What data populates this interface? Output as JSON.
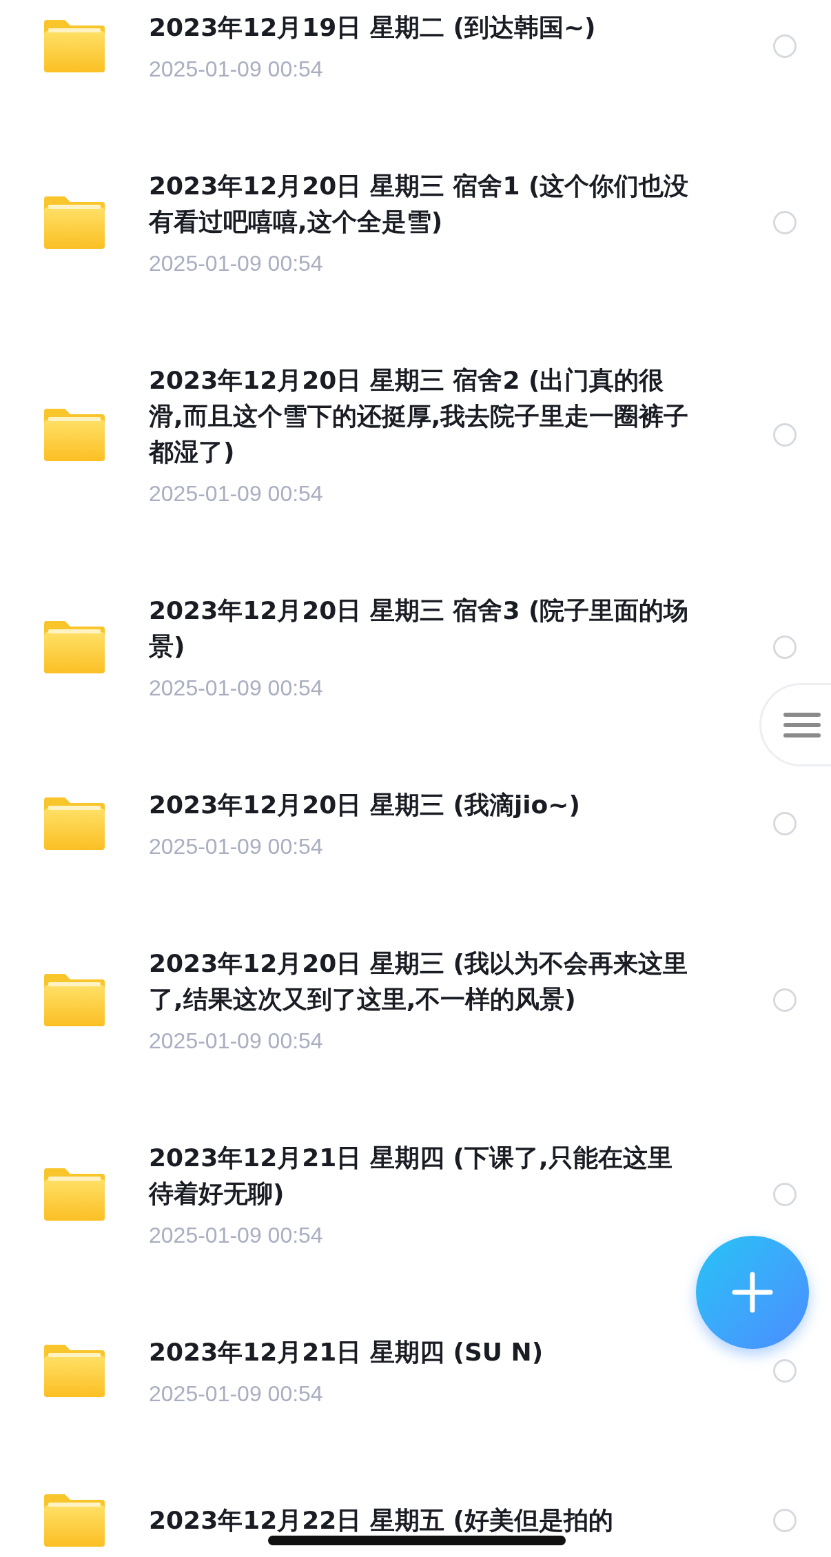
{
  "items": [
    {
      "title": "2023年12月19日 星期二 (到达韩国~)",
      "date": "2025-01-09 00:54",
      "selected": false
    },
    {
      "title": "2023年12月20日 星期三 宿舍1 (这个你们也没有看过吧嘻嘻,这个全是雪)",
      "date": "2025-01-09 00:54",
      "selected": false
    },
    {
      "title": "2023年12月20日 星期三 宿舍2 (出门真的很滑,而且这个雪下的还挺厚,我去院子里走一圈裤子都湿了)",
      "date": "2025-01-09 00:54",
      "selected": false
    },
    {
      "title": "2023年12月20日 星期三 宿舍3 (院子里面的场景)",
      "date": "2025-01-09 00:54",
      "selected": false
    },
    {
      "title": "2023年12月20日 星期三 (我滴jio~)",
      "date": "2025-01-09 00:54",
      "selected": false
    },
    {
      "title": "2023年12月20日 星期三 (我以为不会再来这里了,结果这次又到了这里,不一样的风景)",
      "date": "2025-01-09 00:54",
      "selected": false
    },
    {
      "title": "2023年12月21日 星期四 (下课了,只能在这里待着好无聊)",
      "date": "2025-01-09 00:54",
      "selected": false
    },
    {
      "title": "2023年12月21日 星期四 (SU N)",
      "date": "2025-01-09 00:54",
      "selected": false
    },
    {
      "title": "2023年12月22日 星期五 (好美但是拍的",
      "selected": false
    }
  ]
}
